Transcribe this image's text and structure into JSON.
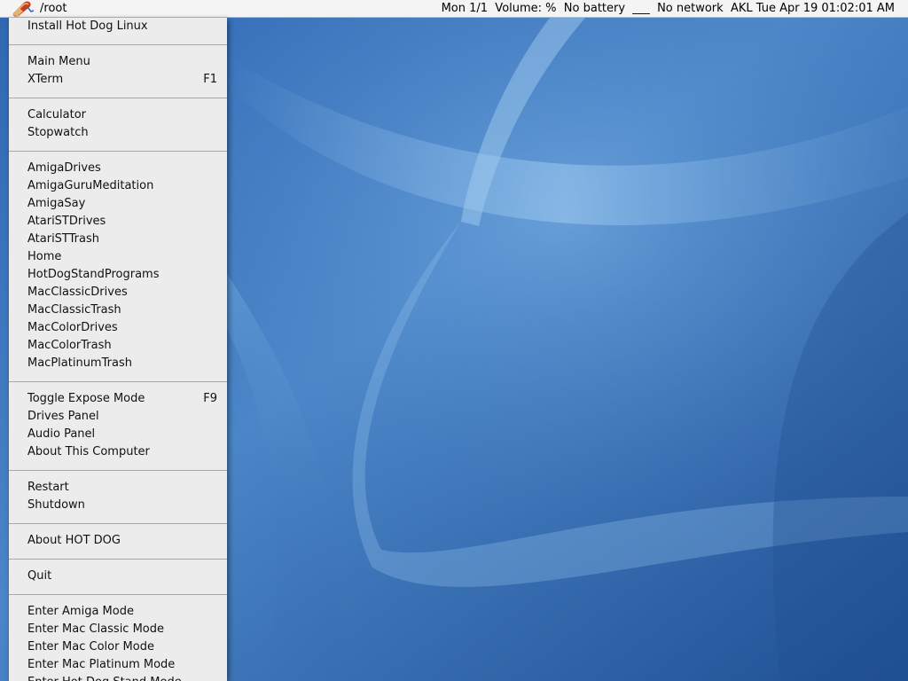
{
  "menubar": {
    "path": "/root",
    "status": "Mon 1/1  Volume: %  No battery  ___  No network  AKL Tue Apr 19 01:02:01 AM",
    "icon": "hotdog-logo-icon"
  },
  "menu": {
    "groups": [
      [
        {
          "label": "Install Hot Dog Linux",
          "shortcut": ""
        }
      ],
      [
        {
          "label": "Main Menu",
          "shortcut": ""
        },
        {
          "label": "XTerm",
          "shortcut": "F1"
        }
      ],
      [
        {
          "label": "Calculator",
          "shortcut": ""
        },
        {
          "label": "Stopwatch",
          "shortcut": ""
        }
      ],
      [
        {
          "label": "AmigaDrives",
          "shortcut": ""
        },
        {
          "label": "AmigaGuruMeditation",
          "shortcut": ""
        },
        {
          "label": "AmigaSay",
          "shortcut": ""
        },
        {
          "label": "AtariSTDrives",
          "shortcut": ""
        },
        {
          "label": "AtariSTTrash",
          "shortcut": ""
        },
        {
          "label": "Home",
          "shortcut": ""
        },
        {
          "label": "HotDogStandPrograms",
          "shortcut": ""
        },
        {
          "label": "MacClassicDrives",
          "shortcut": ""
        },
        {
          "label": "MacClassicTrash",
          "shortcut": ""
        },
        {
          "label": "MacColorDrives",
          "shortcut": ""
        },
        {
          "label": "MacColorTrash",
          "shortcut": ""
        },
        {
          "label": "MacPlatinumTrash",
          "shortcut": ""
        }
      ],
      [
        {
          "label": "Toggle Expose Mode",
          "shortcut": "F9"
        },
        {
          "label": "Drives Panel",
          "shortcut": ""
        },
        {
          "label": "Audio Panel",
          "shortcut": ""
        },
        {
          "label": "About This Computer",
          "shortcut": ""
        }
      ],
      [
        {
          "label": "Restart",
          "shortcut": ""
        },
        {
          "label": "Shutdown",
          "shortcut": ""
        }
      ],
      [
        {
          "label": "About HOT DOG",
          "shortcut": ""
        }
      ],
      [
        {
          "label": "Quit",
          "shortcut": ""
        }
      ],
      [
        {
          "label": "Enter Amiga Mode",
          "shortcut": ""
        },
        {
          "label": "Enter Mac Classic Mode",
          "shortcut": ""
        },
        {
          "label": "Enter Mac Color Mode",
          "shortcut": ""
        },
        {
          "label": "Enter Mac Platinum Mode",
          "shortcut": ""
        },
        {
          "label": "Enter Hot Dog Stand Mode",
          "shortcut": ""
        }
      ]
    ]
  },
  "colors": {
    "desktop": "#3e78be",
    "menu_bg": "#ececec",
    "menubar_bg": "#f4f4f4"
  }
}
